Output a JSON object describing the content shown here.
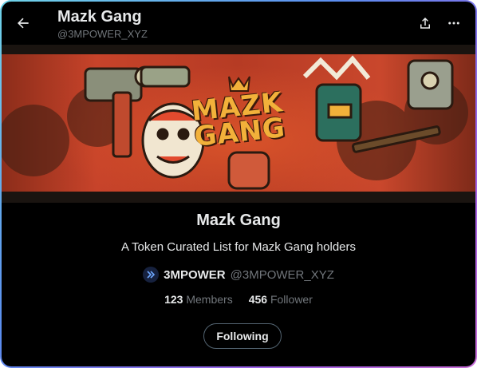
{
  "header": {
    "title": "Mazk Gang",
    "handle": "@3MPOWER_XYZ",
    "icons": [
      "back-arrow-icon",
      "share-icon",
      "more-icon"
    ]
  },
  "banner": {
    "logo_line1": "MAZK",
    "logo_line2": "GANG",
    "colors": {
      "primary_red": "#c7432a",
      "logo_gold": "#f2b13a",
      "dark": "#1a1410"
    }
  },
  "list": {
    "name": "Mazk Gang",
    "description": "A Token Curated List for Mazk Gang holders",
    "owner_name": "3MPOWER",
    "owner_handle": "@3MPOWER_XYZ",
    "members_count": "123",
    "members_label": "Members",
    "followers_count": "456",
    "followers_label": "Follower",
    "follow_button_label": "Following"
  },
  "colors": {
    "background": "#000000",
    "text": "#e7e9ea",
    "muted": "#71767b",
    "border": "#536471"
  }
}
